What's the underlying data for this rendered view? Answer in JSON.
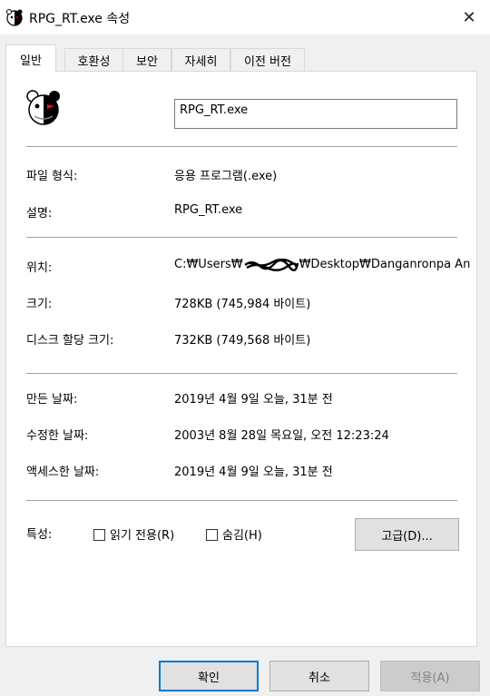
{
  "window": {
    "title": "RPG_RT.exe 속성",
    "icon": "monokuma-icon"
  },
  "tabs": [
    {
      "label": "일반",
      "active": true
    },
    {
      "label": "호환성"
    },
    {
      "label": "보안"
    },
    {
      "label": "자세히"
    },
    {
      "label": "이전 버전"
    }
  ],
  "general": {
    "filename": "RPG_RT.exe",
    "file_type_label": "파일 형식:",
    "file_type_value": "응용 프로그램(.exe)",
    "description_label": "설명:",
    "description_value": "RPG_RT.exe",
    "location_label": "위치:",
    "location_prefix": "C:₩Users₩",
    "location_suffix": "₩Desktop₩Danganronpa An",
    "size_label": "크기:",
    "size_value": "728KB (745,984 바이트)",
    "disk_size_label": "디스크 할당 크기:",
    "disk_size_value": "732KB (749,568 바이트)",
    "created_label": "만든 날짜:",
    "created_value": "2019년 4월 9일 오늘, 31분 전",
    "modified_label": "수정한 날짜:",
    "modified_value": "2003년 8월 28일 목요일, 오전 12:23:24",
    "accessed_label": "액세스한 날짜:",
    "accessed_value": "2019년 4월 9일 오늘, 31분 전",
    "attributes_label": "특성:",
    "readonly_label": "읽기 전용(R)",
    "hidden_label": "숨김(H)",
    "advanced_label": "고급(D)..."
  },
  "footer": {
    "ok_label": "확인",
    "cancel_label": "취소",
    "apply_label": "적용(A)"
  }
}
